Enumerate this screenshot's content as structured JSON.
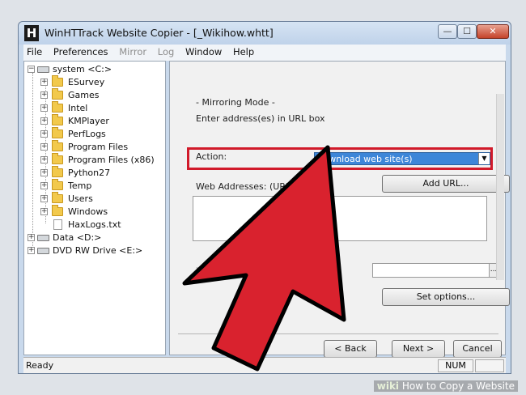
{
  "window": {
    "title": "WinHTTrack Website Copier - [_Wikihow.whtt]",
    "app_icon": "H",
    "min_glyph": "—",
    "max_glyph": "☐",
    "close_glyph": "✕"
  },
  "menu": [
    "File",
    "Preferences",
    "Mirror",
    "Log",
    "Window",
    "Help"
  ],
  "tree": {
    "root": "system <C:>",
    "folders": [
      "ESurvey",
      "Games",
      "Intel",
      "KMPlayer",
      "PerfLogs",
      "Program Files",
      "Program Files (x86)",
      "Python27",
      "Temp",
      "Users",
      "Windows"
    ],
    "file": "HaxLogs.txt",
    "drives": [
      "Data <D:>",
      "DVD RW Drive <E:>"
    ]
  },
  "main": {
    "mode_title": "- Mirroring Mode -",
    "instruction": "Enter address(es) in URL box",
    "action_label": "Action:",
    "action_value": "Download web site(s)",
    "web_addresses_label": "Web Addresses: (URL)",
    "add_url_button": "Add URL...",
    "url_label": "URL",
    "url_browse": "...",
    "set_options_button": "Set options...",
    "back_button": "< Back",
    "next_button": "Next >",
    "cancel_button": "Cancel"
  },
  "status": {
    "text": "Ready",
    "num": "NUM"
  },
  "watermark": {
    "wiki": "wiki",
    "rest": "How to Copy a Website"
  },
  "colors": {
    "highlight_box": "#d11a2a",
    "arrow_fill": "#d9222e",
    "selection": "#3d86d8"
  }
}
